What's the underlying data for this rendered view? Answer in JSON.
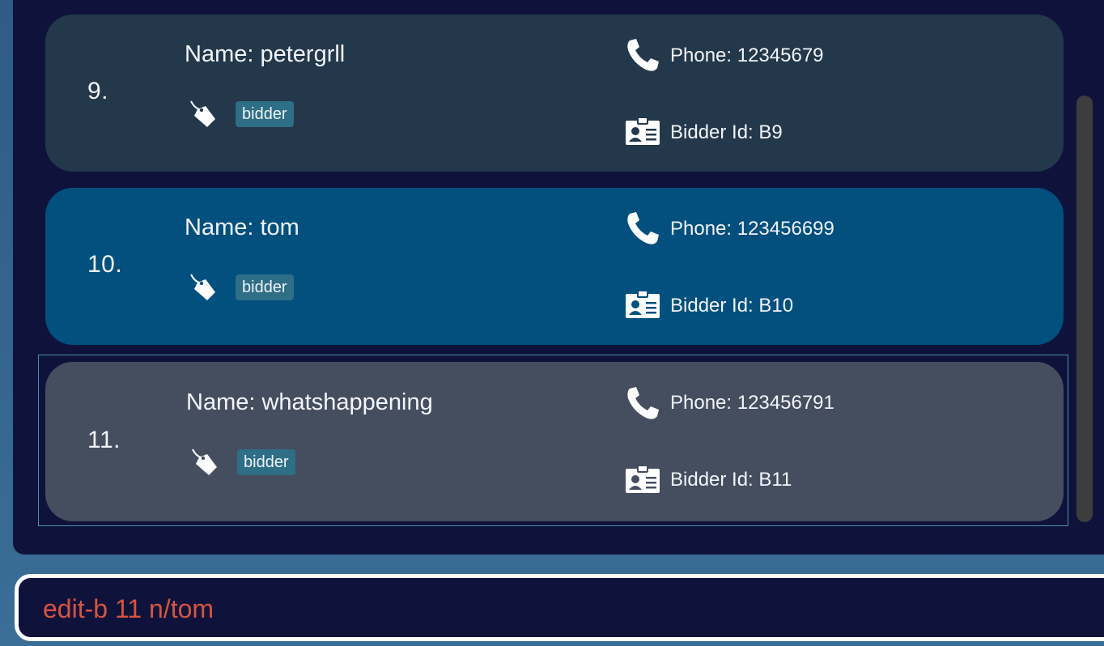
{
  "cards": [
    {
      "index": "9.",
      "name": "Name: petergrll",
      "tag": "bidder",
      "phone": "Phone: 12345679",
      "bidder_id": "Bidder Id: B9"
    },
    {
      "index": "10.",
      "name": "Name: tom",
      "tag": "bidder",
      "phone": "Phone: 123456699",
      "bidder_id": "Bidder Id: B10"
    },
    {
      "index": "11.",
      "name": "Name: whatshappening",
      "tag": "bidder",
      "phone": "Phone: 123456791",
      "bidder_id": "Bidder Id: B11"
    }
  ],
  "command": {
    "value": "edit-b 11 n/tom"
  },
  "icons": {
    "tag": "tag-icon",
    "phone": "phone-icon",
    "id": "id-card-icon"
  },
  "colors": {
    "panel": "#0f133b",
    "card_default": "#23384a",
    "card_hover": "#01507e",
    "card_selected": "#454e5f",
    "tag_badge": "#2e6e86",
    "command_text": "#d8543f"
  }
}
